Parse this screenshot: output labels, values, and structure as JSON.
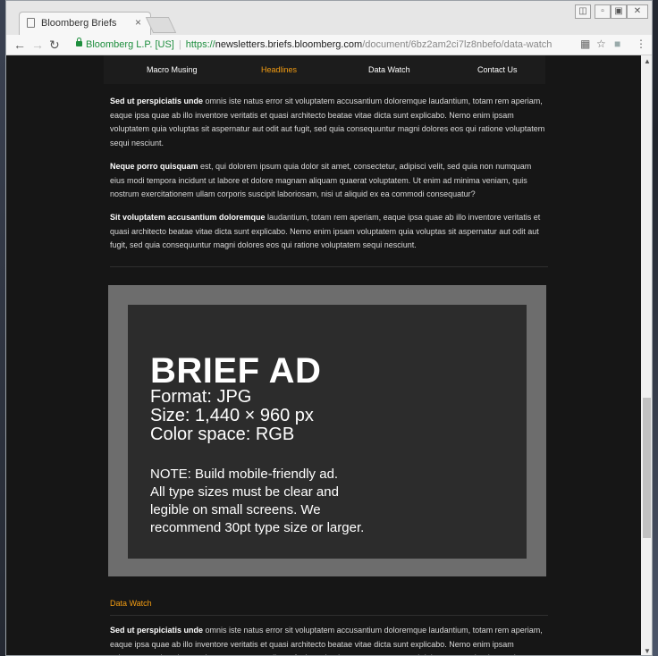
{
  "browser": {
    "tab_title": "Bloomberg Briefs",
    "tab_close": "×",
    "origin_label": "Bloomberg L.P. [US]",
    "url_scheme": "https://",
    "url_host": "newsletters.briefs.bloomberg.com",
    "url_path": "/document/6bz2am2ci7lz8nbefo/data-watch"
  },
  "nav": {
    "items": [
      {
        "label": "Macro Musing"
      },
      {
        "label": "Headlines"
      },
      {
        "label": "Data Watch"
      },
      {
        "label": "Contact Us"
      }
    ]
  },
  "article": {
    "p1_lead": "Sed ut perspiciatis unde",
    "p1_body": " omnis iste natus error sit voluptatem accusantium doloremque laudantium, totam rem aperiam, eaque ipsa quae ab illo inventore veritatis et quasi architecto beatae vitae dicta sunt explicabo. Nemo enim ipsam voluptatem quia voluptas sit aspernatur aut odit aut fugit, sed quia consequuntur magni dolores eos qui ratione voluptatem sequi nesciunt.",
    "p2_lead": "Neque porro quisquam",
    "p2_body": " est, qui dolorem ipsum quia dolor sit amet, consectetur, adipisci velit, sed quia non numquam eius modi tempora incidunt ut labore et dolore magnam aliquam quaerat voluptatem. Ut enim ad minima veniam, quis nostrum exercitationem ullam corporis suscipit laboriosam, nisi ut aliquid ex ea commodi consequatur?",
    "p3_lead": "Sit voluptatem accusantium doloremque",
    "p3_body": " laudantium, totam rem aperiam, eaque ipsa quae ab illo inventore veritatis et quasi architecto beatae vitae dicta sunt explicabo. Nemo enim ipsam voluptatem quia voluptas sit aspernatur aut odit aut fugit, sed quia consequuntur magni dolores eos qui ratione voluptatem sequi nesciunt."
  },
  "ad": {
    "title": "BRIEF AD",
    "format": "Format: JPG",
    "size": "Size: 1,440 × 960 px",
    "color_space": "Color space: RGB",
    "note_lines": [
      "NOTE: Build mobile-friendly ad.",
      "All type sizes must be clear and",
      "legible on small screens. We",
      "recommend 30pt type size or larger."
    ]
  },
  "section": {
    "label": "Data Watch",
    "p_lead": "Sed ut perspiciatis unde",
    "p_body": " omnis iste natus error sit voluptatem accusantium doloremque laudantium, totam rem aperiam, eaque ipsa quae ab illo inventore veritatis et quasi architecto beatae vitae dicta sunt explicabo. Nemo enim ipsam voluptatem quia voluptas sit aspernatur aut odit aut fugit, sed quia consequuntur magni dolores eos qui ratione voluptatem sequi nesciunt."
  },
  "colors": {
    "accent": "#f39c12",
    "page_bg": "#161616",
    "ad_frame": "#6d6d6d",
    "ad_panel": "#2c2c2c"
  },
  "icons": [
    "document-icon",
    "close-icon",
    "back-icon",
    "forward-icon",
    "reload-icon",
    "lock-icon",
    "translate-icon",
    "star-icon",
    "extension-icon",
    "menu-icon",
    "minimize-icon",
    "maximize-icon",
    "window-close-icon"
  ]
}
